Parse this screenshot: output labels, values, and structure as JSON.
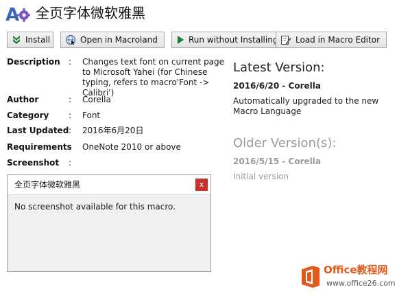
{
  "window": {
    "title": "全页字体微软雅黑",
    "app_icon": "macro-app-icon"
  },
  "toolbar": {
    "install": "Install",
    "open_macroland": "Open in Macroland",
    "run_without_installing": "Run without Installing",
    "load_in_editor": "Load in Macro Editor"
  },
  "details": {
    "description": {
      "label": "Description",
      "sep": ":",
      "value": "Changes text font on current page to Microsoft Yahei (for Chinese typing, refers to macro'Font -> Calibri')"
    },
    "author": {
      "label": "Author",
      "sep": ":",
      "value": "Corella"
    },
    "category": {
      "label": "Category",
      "sep": ":",
      "value": "Font"
    },
    "last_updated": {
      "label": "Last Updated",
      "sep": ":",
      "value": "2016年6月20日"
    },
    "requirements": {
      "label": "Requirements",
      "sep": ":",
      "value": "OneNote 2010 or above"
    },
    "screenshot": {
      "label": "Screenshot",
      "sep": ":"
    }
  },
  "latest": {
    "heading": "Latest Version:",
    "version": "2016/6/20 - Corella",
    "note": "Automatically upgraded to the new Macro Language"
  },
  "older": {
    "heading": "Older Version(s):",
    "version": "2016/5/15 - Corella",
    "note": "Initial version"
  },
  "screenshot_dialog": {
    "title": "全页字体微软雅黑",
    "close": "x",
    "message": "No screenshot available for this macro."
  },
  "watermark": {
    "brand": "Office教程网",
    "url": "www.office26.com"
  },
  "colors": {
    "accent": "#1f7a3a",
    "office_orange": "#e05a1b",
    "close_red": "#c9302c"
  }
}
